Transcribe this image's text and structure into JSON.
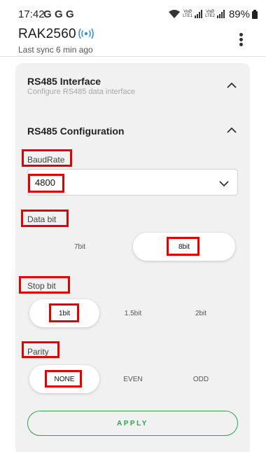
{
  "status_bar": {
    "time": "17:42",
    "g_icons": [
      "G",
      "G",
      "G"
    ],
    "sim1_label": [
      "VoØ",
      "LTE1"
    ],
    "sim2_label": [
      "VoØ",
      "LTE2"
    ],
    "battery": "89%"
  },
  "header": {
    "title": "RAK2560",
    "sync": "Last sync 6 min ago",
    "icons": [
      "broadcast-icon",
      "more-vert-icon"
    ]
  },
  "sections": {
    "interface_title": "RS485 Interface",
    "interface_sub": "Configure RS485 data interface",
    "config_title": "RS485 Configuration"
  },
  "baudrate": {
    "label": "BaudRate",
    "value": "4800"
  },
  "data_bit": {
    "label": "Data bit",
    "options": [
      "7bit",
      "8bit"
    ],
    "selected": "8bit"
  },
  "stop_bit": {
    "label": "Stop bit",
    "options": [
      "1bit",
      "1.5bit",
      "2bit"
    ],
    "selected": "1bit"
  },
  "parity": {
    "label": "Parity",
    "options": [
      "NONE",
      "EVEN",
      "ODD"
    ],
    "selected": "NONE"
  },
  "apply_label": "APPLY",
  "colors": {
    "accent": "#2fa24e",
    "highlight": "#e00000",
    "card": "#f1f1f2"
  }
}
